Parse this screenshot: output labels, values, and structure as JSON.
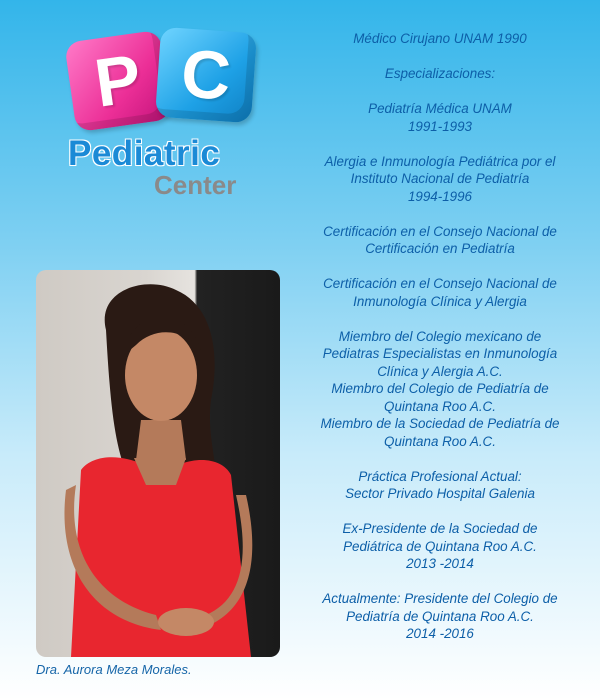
{
  "logo": {
    "letter_p": "P",
    "letter_c": "C",
    "brand_main": "Pediatric",
    "brand_sub": "Center"
  },
  "photo": {
    "caption": "Dra. Aurora Meza Morales."
  },
  "bio": {
    "l01": "Médico Cirujano UNAM  1990",
    "l02": "Especializaciones:",
    "l03": "Pediatría Médica UNAM",
    "l04": "1991-1993",
    "l05": "Alergia e Inmunología Pediátrica por el",
    "l06": "Instituto Nacional de Pediatría",
    "l07": "1994-1996",
    "l08": "Certificación en el Consejo Nacional de",
    "l09": "Certificación en Pediatría",
    "l10": "Certificación en el Consejo Nacional de",
    "l11": "Inmunología Clínica y Alergia",
    "l12": "Miembro del Colegio mexicano de",
    "l13": "Pediatras Especialistas en Inmunología",
    "l14": "Clínica y Alergia A.C.",
    "l15": "Miembro del Colegio de Pediatría de",
    "l16": "Quintana Roo A.C.",
    "l17": "Miembro de la Sociedad de Pediatría de",
    "l18": "Quintana Roo A.C.",
    "l19": "Práctica Profesional Actual:",
    "l20": "Sector Privado Hospital Galenia",
    "l21": "Ex-Presidente de la Sociedad de",
    "l22": "Pediátrica de Quintana Roo A.C.",
    "l23": "2013 -2014",
    "l24": "Actualmente: Presidente del Colegio de",
    "l25": "Pediatría de Quintana Roo A.C.",
    "l26": "2014 -2016"
  }
}
